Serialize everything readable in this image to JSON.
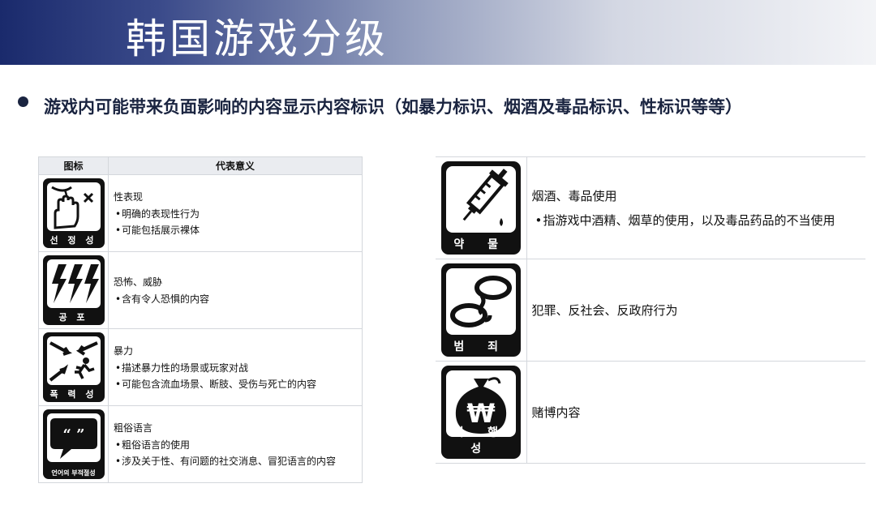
{
  "slide": {
    "title": "韩国游戏分级",
    "bullet": "游戏内可能带来负面影响的内容显示内容标识（如暴力标识、烟酒及毒品标识、性标识等等）"
  },
  "left_table": {
    "headers": [
      "图标",
      "代表意义"
    ],
    "rows": [
      {
        "icon": "sexual-content-hand-icon",
        "label": "선 정 성",
        "title": "性表现",
        "items": [
          "明确的表现性行为",
          "可能包括展示裸体"
        ]
      },
      {
        "icon": "fear-lightning-icon",
        "label": "공 포",
        "title": "恐怖、威胁",
        "items": [
          "含有令人恐惧的内容"
        ]
      },
      {
        "icon": "violence-arrows-runner-icon",
        "label": "폭 력 성",
        "title": "暴力",
        "items": [
          "描述暴力性的场景或玩家对战",
          "可能包含流血场景、断肢、受伤与死亡的内容"
        ]
      },
      {
        "icon": "language-speech-bubble-icon",
        "label": "언어의 부적절성",
        "title": "粗俗语言",
        "items": [
          "粗俗语言的使用",
          "涉及关于性、有问题的社交消息、冒犯语言的内容"
        ]
      }
    ]
  },
  "right_table": {
    "rows": [
      {
        "icon": "drugs-syringe-icon",
        "label": "약 물",
        "title": "烟酒、毒品使用",
        "items": [
          "指游戏中酒精、烟草的使用，以及毒品药品的不当使用"
        ]
      },
      {
        "icon": "crime-handcuffs-icon",
        "label": "범 죄",
        "title": "犯罪、反社会、反政府行为",
        "items": []
      },
      {
        "icon": "gambling-money-bag-icon",
        "label": "사 행 성",
        "title": "赌博内容",
        "items": []
      }
    ]
  }
}
